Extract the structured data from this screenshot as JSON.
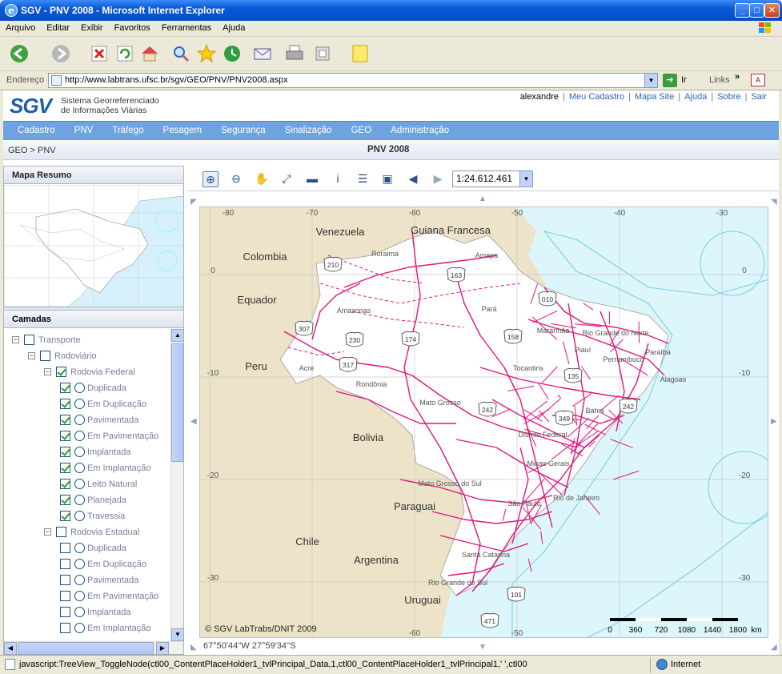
{
  "window": {
    "title": "SGV - PNV 2008 - Microsoft Internet Explorer"
  },
  "menu": [
    "Arquivo",
    "Editar",
    "Exibir",
    "Favoritos",
    "Ferramentas",
    "Ajuda"
  ],
  "address": {
    "label": "Endereço",
    "url": "http://www.labtrans.ufsc.br/sgv/GEO/PNV/PNV2008.aspx",
    "go": "Ir",
    "links": "Links"
  },
  "header": {
    "logo": "SGV",
    "subtitle_line1": "Sistema Georreferenciado",
    "subtitle_line2": "de Informações Viárias",
    "user": "alexandre",
    "links": [
      "Meu Cadastro",
      "Mapa Site",
      "Ajuda",
      "Sobre",
      "Sair"
    ]
  },
  "nav": [
    "Cadastro",
    "PNV",
    "Tráfego",
    "Pesagem",
    "Segurança",
    "Sinalização",
    "GEO",
    "Administração"
  ],
  "breadcrumb": "GEO > PNV",
  "page_title": "PNV 2008",
  "left": {
    "overview_title": "Mapa Resumo",
    "layers_title": "Camadas"
  },
  "tree": [
    {
      "label": "Transporte",
      "level": 0,
      "expand": "-",
      "checkbox": false,
      "radio": false
    },
    {
      "label": "Rodoviário",
      "level": 1,
      "expand": "-",
      "checkbox": false,
      "radio": false
    },
    {
      "label": "Rodovia Federal",
      "level": 2,
      "expand": "-",
      "checkbox": true,
      "radio": false
    },
    {
      "label": "Duplicada",
      "level": 3,
      "expand": "",
      "checkbox": true,
      "radio": true
    },
    {
      "label": "Em Duplicação",
      "level": 3,
      "expand": "",
      "checkbox": true,
      "radio": true
    },
    {
      "label": "Pavimentada",
      "level": 3,
      "expand": "",
      "checkbox": true,
      "radio": true
    },
    {
      "label": "Em Pavimentação",
      "level": 3,
      "expand": "",
      "checkbox": true,
      "radio": true
    },
    {
      "label": "Implantada",
      "level": 3,
      "expand": "",
      "checkbox": true,
      "radio": true
    },
    {
      "label": "Em Implantação",
      "level": 3,
      "expand": "",
      "checkbox": true,
      "radio": true
    },
    {
      "label": "Leito Natural",
      "level": 3,
      "expand": "",
      "checkbox": true,
      "radio": true
    },
    {
      "label": "Planejada",
      "level": 3,
      "expand": "",
      "checkbox": true,
      "radio": true
    },
    {
      "label": "Travessia",
      "level": 3,
      "expand": "",
      "checkbox": true,
      "radio": true
    },
    {
      "label": "Rodovia Estadual",
      "level": 2,
      "expand": "-",
      "checkbox": false,
      "radio": false
    },
    {
      "label": "Duplicada",
      "level": 3,
      "expand": "",
      "checkbox": false,
      "radio": true
    },
    {
      "label": "Em Duplicação",
      "level": 3,
      "expand": "",
      "checkbox": false,
      "radio": true
    },
    {
      "label": "Pavimentada",
      "level": 3,
      "expand": "",
      "checkbox": false,
      "radio": true
    },
    {
      "label": "Em Pavimentação",
      "level": 3,
      "expand": "",
      "checkbox": false,
      "radio": true
    },
    {
      "label": "Implantada",
      "level": 3,
      "expand": "",
      "checkbox": false,
      "radio": true
    },
    {
      "label": "Em Implantação",
      "level": 3,
      "expand": "",
      "checkbox": false,
      "radio": true
    }
  ],
  "map": {
    "scale": "1:24.612.461",
    "copyright": "© SGV LabTrabs/DNIT 2009",
    "coords": "67°50'44''W 27°59'34''S",
    "lon_labels": [
      "-80",
      "-70",
      "-60",
      "-50",
      "-40",
      "-30"
    ],
    "lat_labels": [
      "0",
      "-10",
      "-20",
      "-30"
    ],
    "lon_labels_bottom": [
      "-60",
      "-50"
    ],
    "countries": [
      "Venezuela",
      "Guiana Francesa",
      "Colombia",
      "Equador",
      "Peru",
      "Bolivia",
      "Paraguai",
      "Chile",
      "Argentina",
      "Uruguai"
    ],
    "states": [
      "Roraima",
      "Amapa",
      "Amazonas",
      "Pará",
      "Maranhão",
      "Rio Grande do Norte",
      "Piauí",
      "Paraíba",
      "Pernambuco",
      "Acre",
      "Rondônia",
      "Tocantins",
      "Alagoas",
      "Bahia",
      "Mato Grosso",
      "Distrito Federal",
      "Minas Gerais",
      "Mato Grosso do Sul",
      "São Paulo",
      "Rio de Janeiro",
      "Santa Catarina",
      "Rio Grande do Sul"
    ],
    "shields": [
      "210",
      "163",
      "010",
      "307",
      "230",
      "174",
      "158",
      "317",
      "135",
      "242",
      "349",
      "242",
      "101",
      "471"
    ],
    "scalebar": [
      "0",
      "360",
      "720",
      "1080",
      "1440",
      "1800",
      "km"
    ]
  },
  "status": {
    "text": "javascript:TreeView_ToggleNode(ctl00_ContentPlaceHolder1_tvlPrincipal_Data,1,ctl00_ContentPlaceHolder1_tvlPrincipal1,' ',ctl00",
    "zone": "Internet"
  },
  "colors": {
    "road": "#e0167f",
    "ocean": "#dcf6fc",
    "land": "#ede3c8",
    "brazil": "#ffffff",
    "nav": "#6fa3df"
  }
}
